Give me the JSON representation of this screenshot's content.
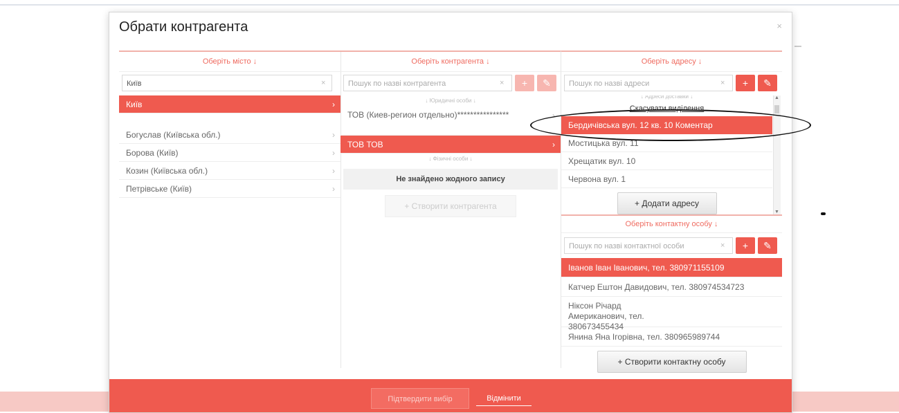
{
  "dialog": {
    "title": "Обрати контрагента",
    "close": "×"
  },
  "city_col": {
    "header": "Оберіть місто ↓",
    "search_value": "Київ",
    "search_clear": "×",
    "items": [
      {
        "label": "Київ",
        "selected": true
      },
      {
        "label": "Богуслав (Київська обл.)",
        "selected": false
      },
      {
        "label": "Борова (Київ)",
        "selected": false
      },
      {
        "label": "Козин (Київська обл.)",
        "selected": false
      },
      {
        "label": "Петрівське (Київ)",
        "selected": false
      }
    ]
  },
  "contractor_col": {
    "header": "Оберіть контрагента ↓",
    "search_placeholder": "Пошук по назві контрагента",
    "search_clear": "×",
    "add_icon": "+",
    "edit_icon": "✎",
    "group_legal": "↓ Юридичні особи ↓",
    "items": [
      {
        "label": "ТОВ (Киев-регион отдельно)****************",
        "selected": false
      },
      {
        "label": "ТОВ ТОВ",
        "selected": true
      }
    ],
    "group_physical": "↓ Фізичні особи ↓",
    "no_records": "Не знайдено жодного запису",
    "create_button": "+ Створити контрагента"
  },
  "address_col": {
    "header": "Оберіть адресу ↓",
    "search_placeholder": "Пошук по назві адреси",
    "search_clear": "×",
    "add_icon": "+",
    "edit_icon": "✎",
    "group_label": "↓ Адреси доставки ↓",
    "cancel_selection": "Скасувати виділення",
    "items": [
      {
        "label": "Бердичівська вул. 12 кв. 10 Коментар",
        "selected": true
      },
      {
        "label": "Мостицька вул. 11",
        "selected": false
      },
      {
        "label": "Хрещатик вул. 10",
        "selected": false
      },
      {
        "label": "Червона вул. 1",
        "selected": false
      }
    ],
    "add_button": "+ Додати адресу",
    "scroll_up": "▲",
    "scroll_down": "▼"
  },
  "contact_col": {
    "header": "Оберіть контактну особу ↓",
    "search_placeholder": "Пошук по назві контактної особи",
    "search_clear": "×",
    "add_icon": "+",
    "edit_icon": "✎",
    "items": [
      {
        "label": "Іванов Іван Іванович, тел. 380971155109",
        "selected": true
      },
      {
        "label": "Катчер Ештон Давидович, тел. 380974534723",
        "selected": false
      },
      {
        "label": "Ніксон Річард Американович, тел. 380673455434",
        "selected": false
      },
      {
        "label": "Янина Яна Ігорівна, тел. 380965989744",
        "selected": false
      }
    ],
    "create_button": "+ Створити контактну особу"
  },
  "footer": {
    "confirm": "Підтвердити вибір",
    "cancel": "Відмінити"
  },
  "colors": {
    "accent": "#ef5a4f",
    "accent_pale": "#f7b6b0",
    "header_text": "#ef6b60"
  }
}
